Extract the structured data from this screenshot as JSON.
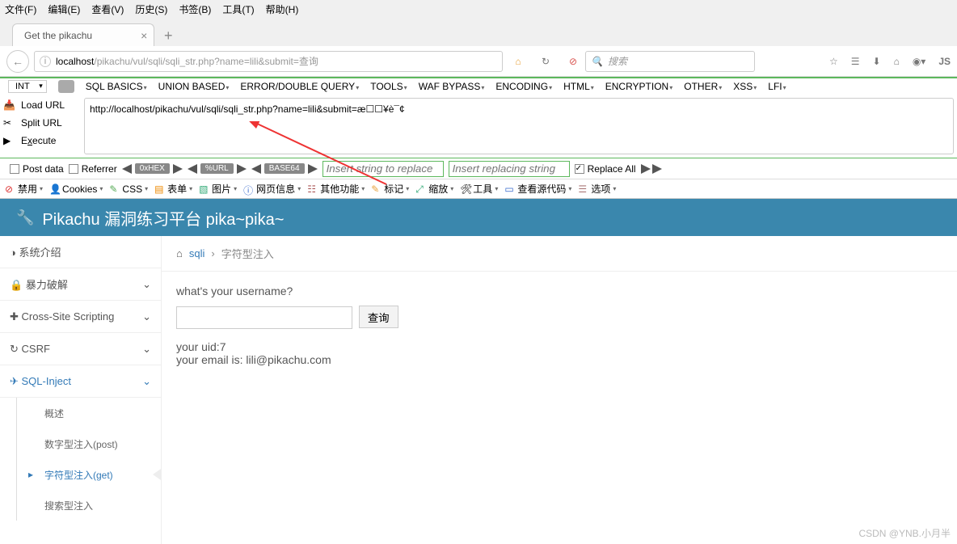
{
  "menu": [
    "文件(F)",
    "编辑(E)",
    "查看(V)",
    "历史(S)",
    "书签(B)",
    "工具(T)",
    "帮助(H)"
  ],
  "tab_title": "Get the pikachu",
  "url_display_host": "localhost",
  "url_display_path": "/pikachu/vul/sqli/sqli_str.php?name=lili&submit=查询",
  "search_placeholder": "搜索",
  "hb_sel": "INT",
  "hb_toolbar": [
    "SQL BASICS",
    "UNION BASED",
    "ERROR/DOUBLE QUERY",
    "TOOLS",
    "WAF BYPASS",
    "ENCODING",
    "HTML",
    "ENCRYPTION",
    "OTHER",
    "XSS",
    "LFI"
  ],
  "hb_left": {
    "load": "Load URL",
    "split": "Split URL",
    "execute": "Execute"
  },
  "hb_url": "http://localhost/pikachu/vul/sqli/sqli_str.php?name=lili&submit=æ☐☐¥è¯¢",
  "hb_bottom": {
    "post": "Post data",
    "referrer": "Referrer",
    "hex": "0xHEX",
    "url": "%URL",
    "b64": "BASE64",
    "ins1": "Insert string to replace",
    "ins2": "Insert replacing string",
    "repl": "Replace All"
  },
  "devbar": [
    "禁用",
    "Cookies",
    "CSS",
    "表单",
    "图片",
    "网页信息",
    "其他功能",
    "标记",
    "缩放",
    "工具",
    "查看源代码",
    "选项"
  ],
  "pika_title": "Pikachu 漏洞练习平台 pika~pika~",
  "sidebar": {
    "intro": "系统介绍",
    "brute": "暴力破解",
    "xss": "Cross-Site Scripting",
    "csrf": "CSRF",
    "sqli": "SQL-Inject",
    "subs": [
      "概述",
      "数字型注入(post)",
      "字符型注入(get)",
      "搜索型注入"
    ]
  },
  "bc": {
    "home": "sqli",
    "sep": "›",
    "current": "字符型注入"
  },
  "page": {
    "q": "what's your username?",
    "btn": "查询",
    "uid": "your uid:7",
    "email": "your email is: lili@pikachu.com"
  },
  "watermark": "CSDN @YNB.小月半"
}
